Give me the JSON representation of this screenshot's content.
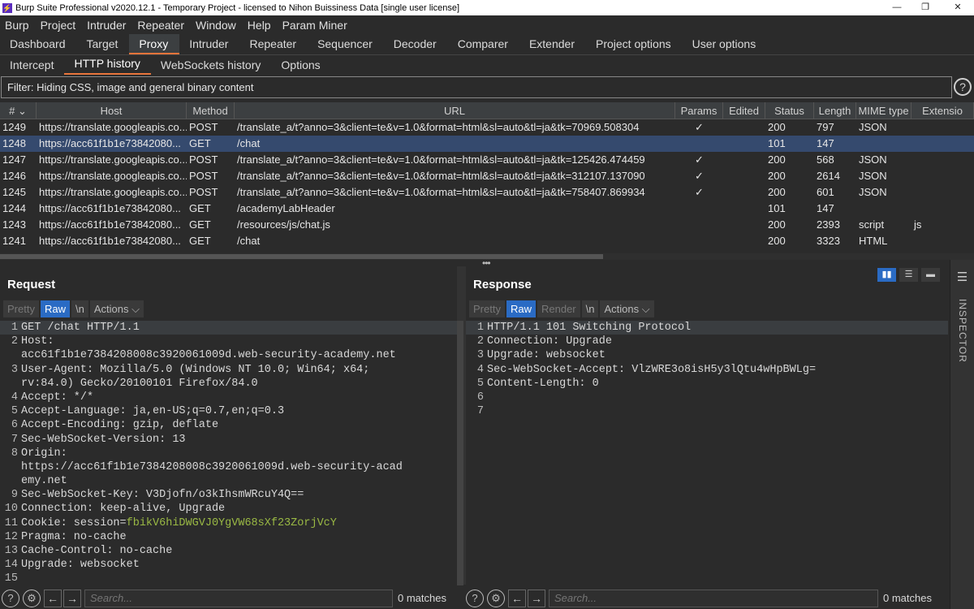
{
  "window": {
    "title": "Burp Suite Professional v2020.12.1 - Temporary Project - licensed to Nihon Buissiness Data [single user license]",
    "minimize": "—",
    "restore": "❐",
    "close": "✕"
  },
  "menu": [
    "Burp",
    "Project",
    "Intruder",
    "Repeater",
    "Window",
    "Help",
    "Param Miner"
  ],
  "main_tabs": [
    "Dashboard",
    "Target",
    "Proxy",
    "Intruder",
    "Repeater",
    "Sequencer",
    "Decoder",
    "Comparer",
    "Extender",
    "Project options",
    "User options"
  ],
  "main_tab_active": "Proxy",
  "proxy_tabs": [
    "Intercept",
    "HTTP history",
    "WebSockets history",
    "Options"
  ],
  "proxy_tab_active": "HTTP history",
  "filter": "Filter: Hiding CSS, image and general binary content",
  "help_icon": "?",
  "table": {
    "headers": [
      "# ⌄",
      "Host",
      "Method",
      "URL",
      "Params",
      "Edited",
      "Status",
      "Length",
      "MIME type",
      "Extensio"
    ],
    "rows": [
      [
        "1249",
        "https://translate.googleapis.co...",
        "POST",
        "/translate_a/t?anno=3&client=te&v=1.0&format=html&sl=auto&tl=ja&tk=70969.508304",
        "✓",
        "",
        "200",
        "797",
        "JSON",
        ""
      ],
      [
        "1248",
        "https://acc61f1b1e73842080...",
        "GET",
        "/chat",
        "",
        "",
        "101",
        "147",
        "",
        ""
      ],
      [
        "1247",
        "https://translate.googleapis.co...",
        "POST",
        "/translate_a/t?anno=3&client=te&v=1.0&format=html&sl=auto&tl=ja&tk=125426.474459",
        "✓",
        "",
        "200",
        "568",
        "JSON",
        ""
      ],
      [
        "1246",
        "https://translate.googleapis.co...",
        "POST",
        "/translate_a/t?anno=3&client=te&v=1.0&format=html&sl=auto&tl=ja&tk=312107.137090",
        "✓",
        "",
        "200",
        "2614",
        "JSON",
        ""
      ],
      [
        "1245",
        "https://translate.googleapis.co...",
        "POST",
        "/translate_a/t?anno=3&client=te&v=1.0&format=html&sl=auto&tl=ja&tk=758407.869934",
        "✓",
        "",
        "200",
        "601",
        "JSON",
        ""
      ],
      [
        "1244",
        "https://acc61f1b1e73842080...",
        "GET",
        "/academyLabHeader",
        "",
        "",
        "101",
        "147",
        "",
        ""
      ],
      [
        "1243",
        "https://acc61f1b1e73842080...",
        "GET",
        "/resources/js/chat.js",
        "",
        "",
        "200",
        "2393",
        "script",
        "js"
      ],
      [
        "1241",
        "https://acc61f1b1e73842080...",
        "GET",
        "/chat",
        "",
        "",
        "200",
        "3323",
        "HTML",
        ""
      ]
    ],
    "selected_row": 1
  },
  "splitter": "•••",
  "request": {
    "title": "Request",
    "buttons": [
      "Pretty",
      "Raw",
      "\\n",
      "Actions ⌵"
    ],
    "active": "Raw",
    "line_numbers": [
      "1",
      "2",
      "",
      "3",
      "",
      "4",
      "5",
      "6",
      "7",
      "8",
      "",
      "",
      "9",
      "10",
      "11",
      "12",
      "13",
      "14",
      "15"
    ],
    "lines": [
      "GET /chat HTTP/1.1",
      "Host:",
      "acc61f1b1e7384208008c3920061009d.web-security-academy.net",
      "User-Agent: Mozilla/5.0 (Windows NT 10.0; Win64; x64;",
      "rv:84.0) Gecko/20100101 Firefox/84.0",
      "Accept: */*",
      "Accept-Language: ja,en-US;q=0.7,en;q=0.3",
      "Accept-Encoding: gzip, deflate",
      "Sec-WebSocket-Version: 13",
      "Origin:",
      "https://acc61f1b1e7384208008c3920061009d.web-security-acad",
      "emy.net",
      "Sec-WebSocket-Key: V3Djofn/o3kIhsmWRcuY4Q==",
      "Connection: keep-alive, Upgrade",
      "Cookie: session=",
      "Pragma: no-cache",
      "Cache-Control: no-cache",
      "Upgrade: websocket",
      ""
    ],
    "cookie_value": "fbikV6hiDWGVJ0YgVW68sXf23ZorjVcY"
  },
  "response": {
    "title": "Response",
    "buttons": [
      "Pretty",
      "Raw",
      "Render",
      "\\n",
      "Actions ⌵"
    ],
    "active": "Raw",
    "line_numbers": [
      "1",
      "2",
      "3",
      "4",
      "5",
      "6",
      "7"
    ],
    "lines": [
      "HTTP/1.1 101 Switching Protocol",
      "Connection: Upgrade",
      "Upgrade: websocket",
      "Sec-WebSocket-Accept: VlzWRE3o8isH5y3lQtu4wHpBWLg=",
      "Content-Length: 0",
      "",
      ""
    ]
  },
  "search": {
    "placeholder": "Search...",
    "matches": "0 matches"
  },
  "inspector": "INSPECTOR",
  "colors": {
    "accent": "#e8743b",
    "selected": "#2a6bc4",
    "cookie": "#9ab944"
  }
}
